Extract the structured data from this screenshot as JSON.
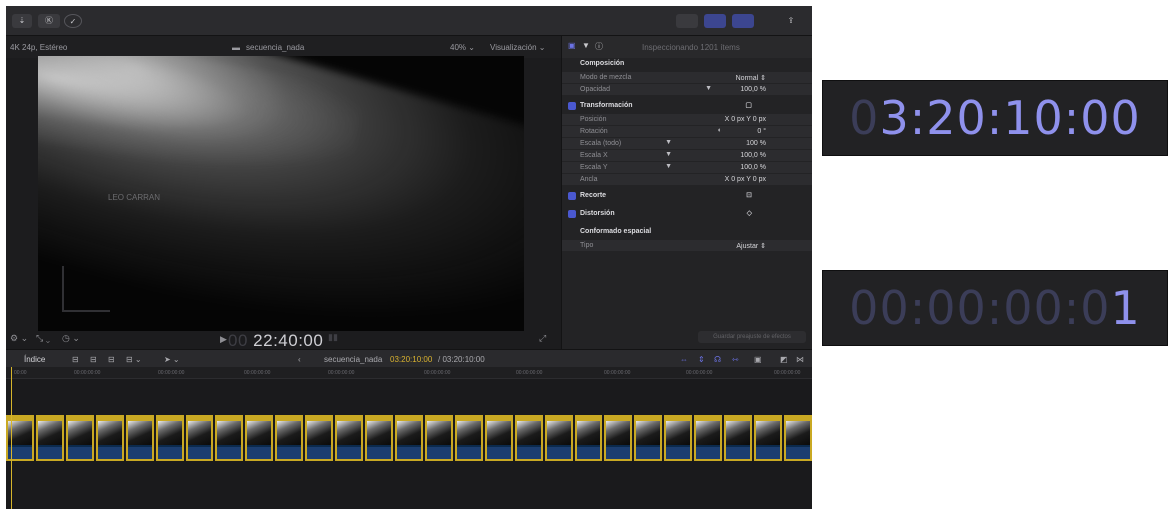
{
  "toolbar": {
    "import_label": "⇣",
    "keywords_label": "Ⓚ",
    "check_label": "✓"
  },
  "viewer": {
    "format": "4K 24p, Estéreo",
    "sequence_name": "secuencia_nada",
    "zoom": "40%",
    "view_menu": "Visualización",
    "overlay_text": "LEO CARRAN",
    "timecode": "22:40:00",
    "timecode_prefix": "00"
  },
  "inspector": {
    "header": "Inspeccionando 1201 ítems",
    "sections": [
      {
        "title": "Composición",
        "checkbox": false,
        "rows": [
          {
            "label": "Modo de mezcla",
            "value": "Normal ⇕"
          },
          {
            "label": "Opacidad",
            "value": "100,0 %"
          }
        ]
      },
      {
        "title": "Transformación",
        "checkbox": true,
        "rows": [
          {
            "label": "Posición",
            "value": "X   0 px   Y   0 px"
          },
          {
            "label": "Rotación",
            "value": "0 °"
          },
          {
            "label": "Escala (todo)",
            "value": "100 %"
          },
          {
            "label": "Escala X",
            "value": "100,0 %"
          },
          {
            "label": "Escala Y",
            "value": "100,0 %"
          },
          {
            "label": "Ancla",
            "value": "X   0 px   Y   0 px"
          }
        ]
      },
      {
        "title": "Recorte",
        "checkbox": true,
        "rows": []
      },
      {
        "title": "Distorsión",
        "checkbox": true,
        "rows": []
      },
      {
        "title": "Conformado espacial",
        "checkbox": false,
        "rows": [
          {
            "label": "Tipo",
            "value": "Ajustar ⇕"
          }
        ]
      }
    ],
    "save_button": "Guardar preajuste de efectos"
  },
  "timeline": {
    "index_label": "Índice",
    "sequence_name": "secuencia_nada",
    "position": "03:20:10:00",
    "duration": "/ 03:20:10:00",
    "ruler": [
      "00:00",
      "00:00:00:00",
      "00:00:00:00",
      "00:00:00:00",
      "00:00:00:00",
      "00:00:00:00",
      "00:00:00:00",
      "00:00:00:00",
      "00:00:00:00",
      "00:00:00:00"
    ],
    "clip_count": 27
  },
  "timecode_panels": [
    {
      "dim": "0",
      "lit": "3:20:10:00"
    },
    {
      "dim": "00:00:00:0",
      "lit": "1"
    }
  ],
  "colors": {
    "accent_blue": "#8f91ec",
    "clip_outline": "#c9a923",
    "clip_fill": "#0b2a4d",
    "background": "#1c1c1e"
  }
}
